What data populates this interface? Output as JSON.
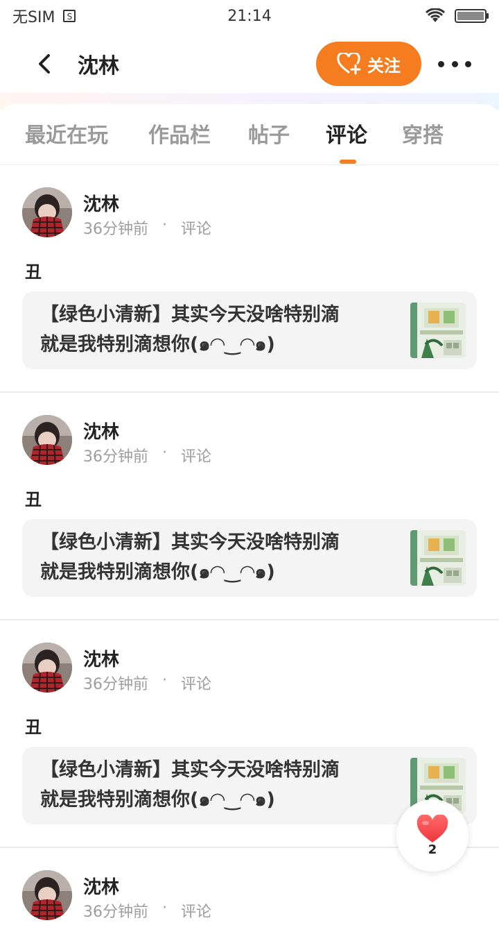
{
  "status_bar": {
    "carrier": "无SIM",
    "sim_icon_label": "S",
    "time": "21:14",
    "wifi_icon": "wifi-icon",
    "battery_icon": "battery-icon"
  },
  "header": {
    "title": "沈林",
    "follow_label": "关注",
    "back_icon": "back-chevron-icon",
    "more_icon": "more-dots-icon",
    "accent_color": "#f57c1f"
  },
  "tabs": [
    {
      "label": "最近在玩",
      "active": false
    },
    {
      "label": "作品栏",
      "active": false
    },
    {
      "label": "帖子",
      "active": false
    },
    {
      "label": "评论",
      "active": true
    },
    {
      "label": "穿搭",
      "active": false
    }
  ],
  "feed": [
    {
      "author": "沈林",
      "time_ago": "36分钟前",
      "separator": "·",
      "type": "评论",
      "comment": "丑",
      "quote_line1": "【绿色小清新】其实今天没啥特别滴",
      "quote_line2": "就是我特别滴想你(๑◠‿◠๑)"
    },
    {
      "author": "沈林",
      "time_ago": "36分钟前",
      "separator": "·",
      "type": "评论",
      "comment": "丑",
      "quote_line1": "【绿色小清新】其实今天没啥特别滴",
      "quote_line2": "就是我特别滴想你(๑◠‿◠๑)"
    },
    {
      "author": "沈林",
      "time_ago": "36分钟前",
      "separator": "·",
      "type": "评论",
      "comment": "丑",
      "quote_line1": "【绿色小清新】其实今天没啥特别滴",
      "quote_line2": "就是我特别滴想你(๑◠‿◠๑)"
    },
    {
      "author": "沈林",
      "time_ago": "36分钟前",
      "separator": "·",
      "type": "评论"
    }
  ],
  "like_fab": {
    "icon": "heart-icon",
    "count": "2",
    "heart_color": "#ff4d4f"
  }
}
